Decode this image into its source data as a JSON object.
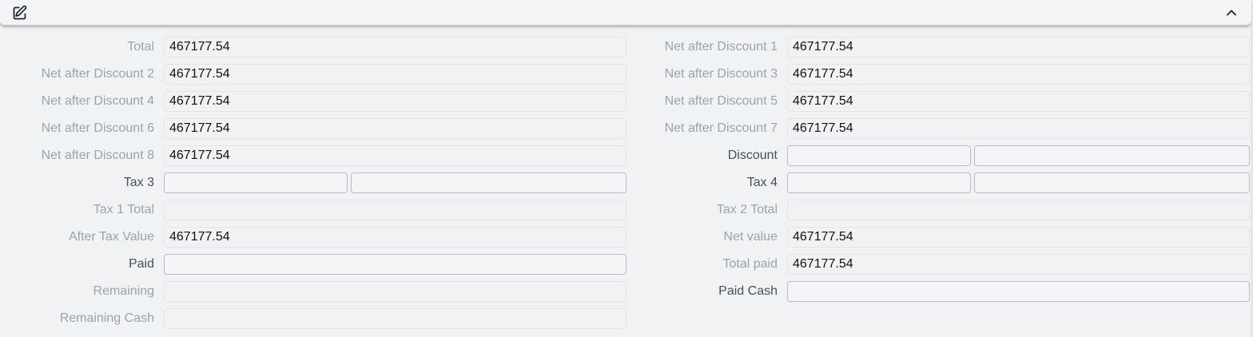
{
  "left": [
    {
      "key": "total",
      "label": "Total",
      "value": "467177.54",
      "active": false,
      "type": "full"
    },
    {
      "key": "nad2",
      "label": "Net after Discount 2",
      "value": "467177.54",
      "active": false,
      "type": "full"
    },
    {
      "key": "nad4",
      "label": "Net after Discount 4",
      "value": "467177.54",
      "active": false,
      "type": "full"
    },
    {
      "key": "nad6",
      "label": "Net after Discount 6",
      "value": "467177.54",
      "active": false,
      "type": "full"
    },
    {
      "key": "nad8",
      "label": "Net after Discount 8",
      "value": "467177.54",
      "active": false,
      "type": "full"
    },
    {
      "key": "tax3",
      "label": "Tax 3",
      "value": "",
      "active": true,
      "type": "split"
    },
    {
      "key": "tax1total",
      "label": "Tax 1 Total",
      "value": "",
      "active": false,
      "type": "full"
    },
    {
      "key": "aftertax",
      "label": "After Tax Value",
      "value": "467177.54",
      "active": false,
      "type": "full"
    },
    {
      "key": "paid",
      "label": "Paid",
      "value": "",
      "active": true,
      "type": "editable"
    },
    {
      "key": "remaining",
      "label": "Remaining",
      "value": "",
      "active": false,
      "type": "full"
    },
    {
      "key": "remainingcash",
      "label": "Remaining Cash",
      "value": "",
      "active": false,
      "type": "full"
    }
  ],
  "right": [
    {
      "key": "nad1",
      "label": "Net after Discount 1",
      "value": "467177.54",
      "active": false,
      "type": "full"
    },
    {
      "key": "nad3",
      "label": "Net after Discount 3",
      "value": "467177.54",
      "active": false,
      "type": "full"
    },
    {
      "key": "nad5",
      "label": "Net after Discount 5",
      "value": "467177.54",
      "active": false,
      "type": "full"
    },
    {
      "key": "nad7",
      "label": "Net after Discount 7",
      "value": "467177.54",
      "active": false,
      "type": "full"
    },
    {
      "key": "discount",
      "label": "Discount",
      "value": "",
      "active": true,
      "type": "split"
    },
    {
      "key": "tax4",
      "label": "Tax 4",
      "value": "",
      "active": true,
      "type": "split"
    },
    {
      "key": "tax2total",
      "label": "Tax 2 Total",
      "value": "",
      "active": false,
      "type": "full"
    },
    {
      "key": "netvalue",
      "label": "Net value",
      "value": "467177.54",
      "active": false,
      "type": "full"
    },
    {
      "key": "totalpaid",
      "label": "Total paid",
      "value": "467177.54",
      "active": false,
      "type": "full"
    },
    {
      "key": "paidcash",
      "label": "Paid Cash",
      "value": "",
      "active": true,
      "type": "editable"
    }
  ],
  "icons": {
    "edit": "edit-icon",
    "collapse": "chevron-up-icon"
  }
}
